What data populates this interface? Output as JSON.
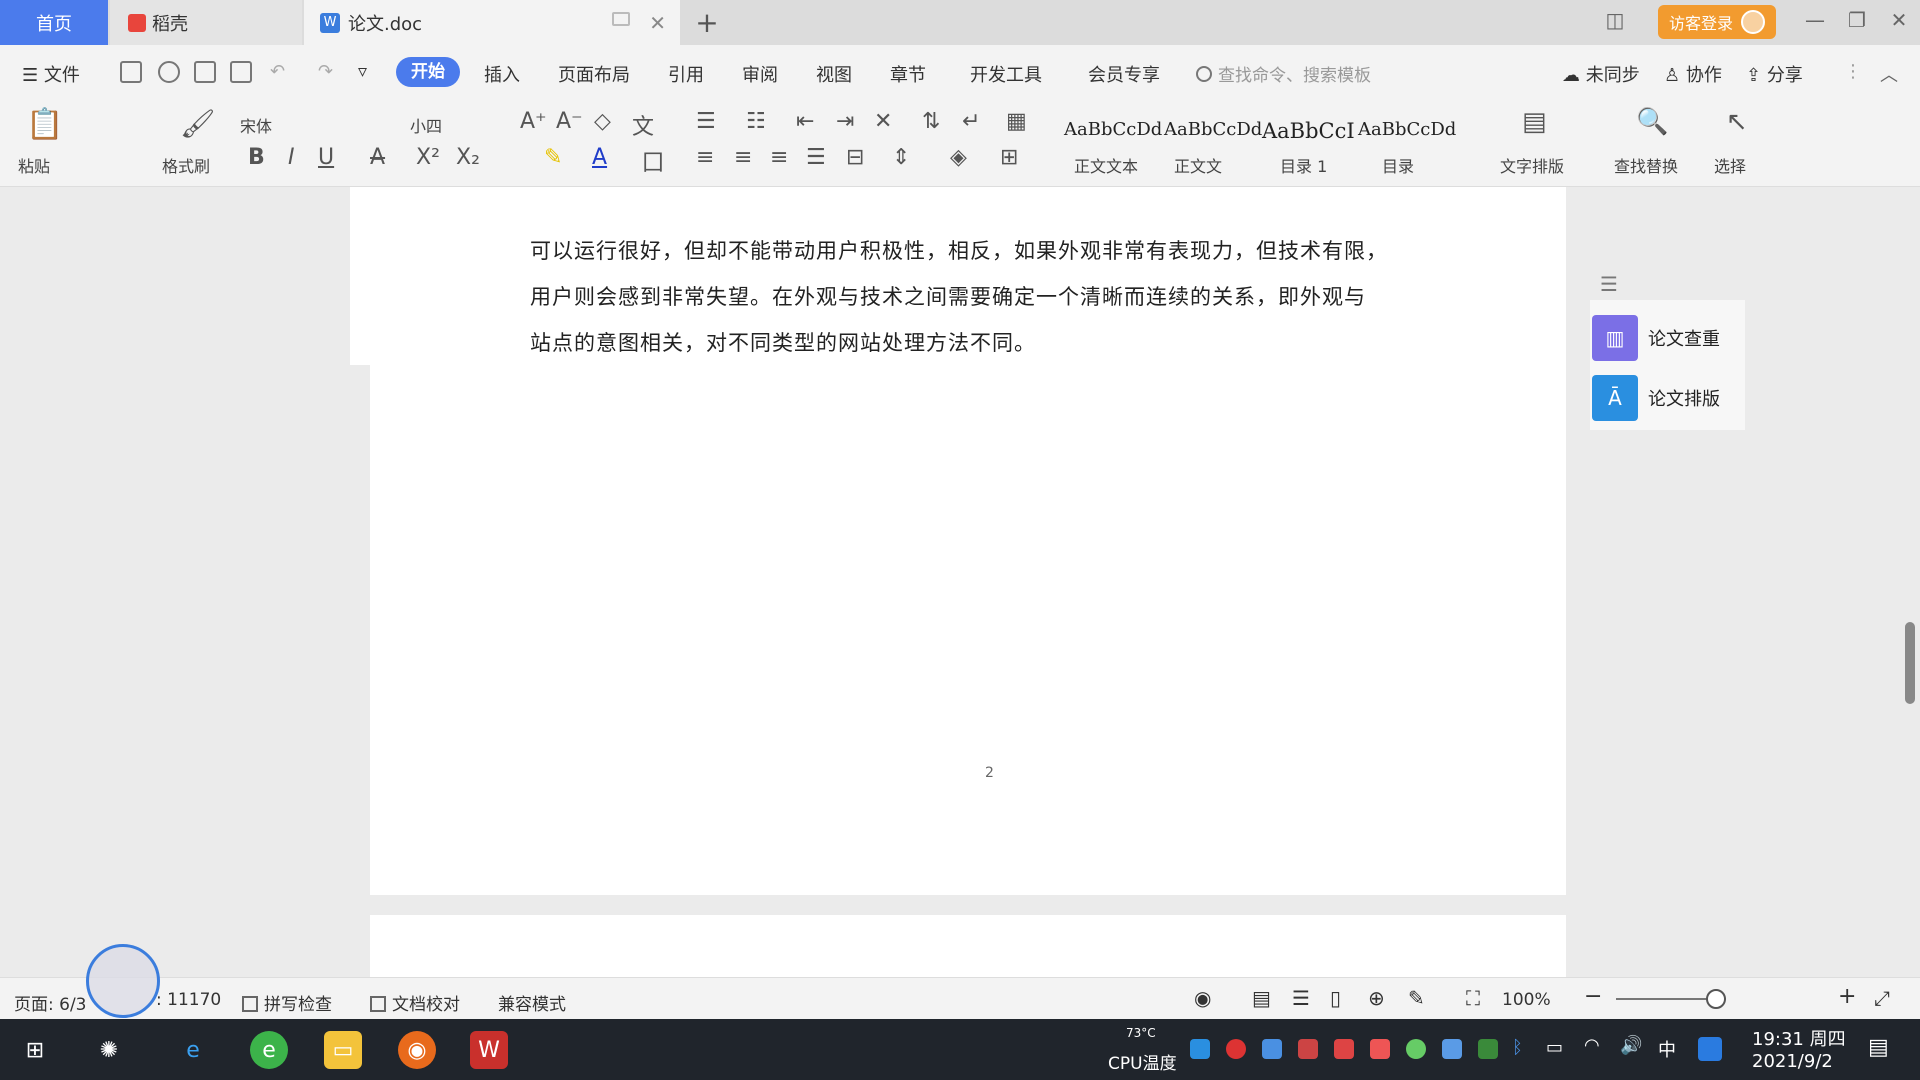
{
  "tabs": {
    "home": "首页",
    "docer": "稻壳",
    "doc": "论文.doc",
    "login": "访客登录"
  },
  "menu": {
    "file": "文件",
    "items": [
      "开始",
      "插入",
      "页面布局",
      "引用",
      "审阅",
      "视图",
      "章节",
      "开发工具",
      "会员专享"
    ],
    "search_placeholder": "查找命令、搜索模板",
    "sync": "未同步",
    "collab": "协作",
    "share": "分享"
  },
  "ribbon": {
    "paste": "粘贴",
    "format_painter": "格式刷",
    "font": "宋体",
    "font_size": "小四",
    "styles": [
      {
        "sample": "AaBbCcDd",
        "name": "正文文本"
      },
      {
        "sample": "AaBbCcDd",
        "name": "正文文"
      },
      {
        "sample": "AaBbCcI",
        "name": "目录 1"
      },
      {
        "sample": "AaBbCcDd",
        "name": "目录"
      }
    ],
    "text_layout": "文字排版",
    "find_replace": "查找替换",
    "select": "选择"
  },
  "document": {
    "lines": [
      "可以运行很好，但却不能带动用户积极性，相反，如果外观非常有表现力，但技术有限，",
      "用户则会感到非常失望。在外观与技术之间需要确定一个清晰而连续的关系，即外观与",
      "站点的意图相关，对不同类型的网站处理方法不同。"
    ],
    "page_number": "2"
  },
  "side_panel": {
    "check": "论文查重",
    "layout": "论文排版"
  },
  "status": {
    "page": "页面: 6/3",
    "words": ": 11170",
    "spell": "拼写检查",
    "proof": "文档校对",
    "compat": "兼容模式",
    "zoom": "100%"
  },
  "taskbar": {
    "cpu_temp": "73°C",
    "cpu_label": "CPU温度",
    "ime": "中",
    "time": "19:31 周四",
    "date": "2021/9/2"
  },
  "colors": {
    "accent": "#4b7bec",
    "login": "#f29b2f",
    "taskbar": "#20252c"
  }
}
